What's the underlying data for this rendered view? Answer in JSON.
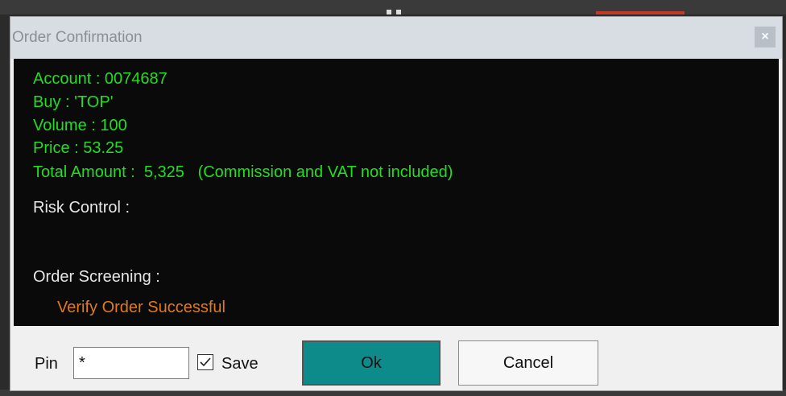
{
  "window": {
    "title": "Order Confirmation",
    "close_glyph": "×"
  },
  "order": {
    "account": "Account : 0074687",
    "side": "Buy : 'TOP'",
    "volume": "Volume : 100",
    "price": "Price : 53.25",
    "total_amount": "Total Amount :  5,325   (Commission and VAT not included)",
    "risk_control_label": "Risk Control :",
    "order_screening_label": "Order Screening :",
    "screening_result": "Verify Order Successful"
  },
  "footer": {
    "pin_label": "Pin",
    "pin_value": "*",
    "save_label": "Save",
    "save_checked": true,
    "ok_label": "Ok",
    "cancel_label": "Cancel"
  },
  "colors": {
    "info_text": "#22dd22",
    "label_text": "#e6e6e6",
    "success_text": "#e07a1a",
    "ok_button": "#0d8a8a"
  }
}
